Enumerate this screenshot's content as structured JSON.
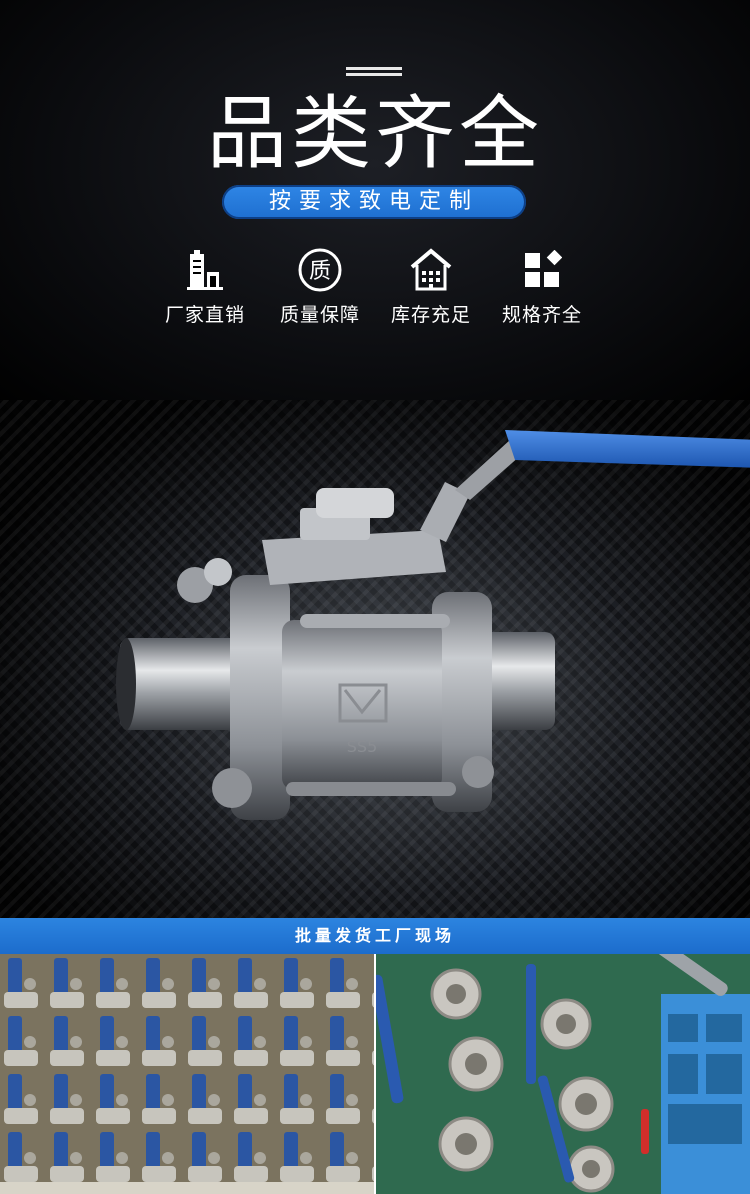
{
  "header": {
    "title": "品类齐全",
    "subtitle": "按要求致电定制"
  },
  "features": [
    {
      "icon": "factory-icon",
      "label": "厂家直销"
    },
    {
      "icon": "quality-icon",
      "label": "质量保障",
      "glyph": "质"
    },
    {
      "icon": "warehouse-icon",
      "label": "库存充足"
    },
    {
      "icon": "grid-icon",
      "label": "规格齐全"
    }
  ],
  "product": {
    "body_marking": "SS5"
  },
  "banner": {
    "text": "批量发货工厂现场"
  },
  "colors": {
    "accent_blue": "#2478da",
    "handle_blue": "#2a6ccc",
    "steel": "#b9bcc0"
  }
}
